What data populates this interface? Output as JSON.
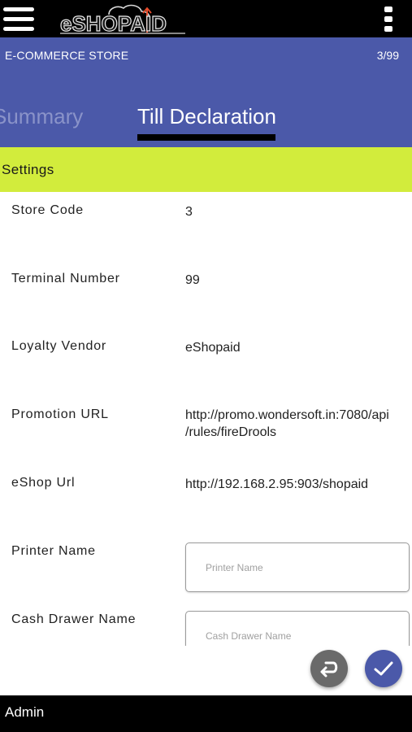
{
  "app": {
    "logo_text": "eSHOPAID",
    "menu_icon": "hamburger-menu-icon",
    "overflow_icon": "more-vertical-icon"
  },
  "header": {
    "store_title": "E-COMMERCE STORE",
    "counter": "3/99"
  },
  "tabs": [
    {
      "label": "Summary"
    },
    {
      "label": "Till Declaration"
    }
  ],
  "section": {
    "title": "Settings"
  },
  "settings": {
    "store_code": {
      "label": "Store Code",
      "value": "3"
    },
    "terminal_number": {
      "label": "Terminal Number",
      "value": "99"
    },
    "loyalty_vendor": {
      "label": "Loyalty Vendor",
      "value": "eShopaid"
    },
    "promotion_url": {
      "label": "Promotion URL",
      "value_line1": "http://promo.wondersoft.in:7080/api",
      "value_line2": "/rules/fireDrools"
    },
    "eshop_url": {
      "label": "eShop Url",
      "value": "http://192.168.2.95:903/shopaid"
    },
    "printer_name": {
      "label": "Printer Name",
      "placeholder": "Printer Name",
      "value": ""
    },
    "cash_drawer_name": {
      "label": "Cash Drawer Name",
      "placeholder": "Cash Drawer Name",
      "value": ""
    }
  },
  "actions": {
    "back_icon": "return-arrow-icon",
    "confirm_icon": "checkmark-icon"
  },
  "footer": {
    "user": "Admin"
  },
  "colors": {
    "topbar": "#000000",
    "header": "#4b59a9",
    "section_bar": "#d2ec3c",
    "fab_back": "#6a6a6a",
    "fab_confirm": "#4b59a9",
    "logo_accent": "#e74c2b"
  }
}
